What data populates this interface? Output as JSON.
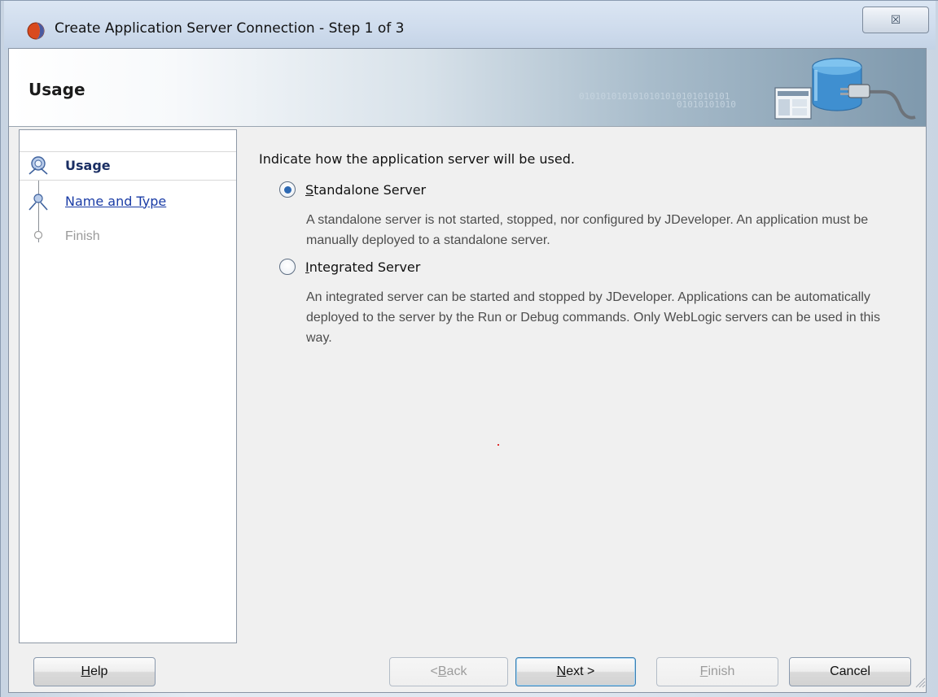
{
  "window": {
    "title": "Create Application Server Connection - Step 1 of 3",
    "close_glyph": "☒"
  },
  "banner": {
    "title": "Usage",
    "binary_1": "0101010101010101010101010101",
    "binary_2": "01010101010"
  },
  "nav": {
    "items": [
      {
        "label": "Usage",
        "state": "current"
      },
      {
        "label": "Name and Type",
        "state": "link"
      },
      {
        "label": "Finish",
        "state": "disabled"
      }
    ]
  },
  "content": {
    "prompt": "Indicate how  the application server will be used.",
    "options": [
      {
        "mnemonic": "S",
        "label_rest": "tandalone Server",
        "selected": true,
        "description": "A standalone server is not started, stopped, nor configured by JDeveloper. An application must be manually deployed to a standalone server."
      },
      {
        "mnemonic": "I",
        "label_rest": "ntegrated Server",
        "selected": false,
        "description": "An integrated server can be started and stopped by JDeveloper. Applications can be automatically deployed to the server by the Run or Debug commands. Only WebLogic servers can be used in this way."
      }
    ]
  },
  "buttons": {
    "help": {
      "mnemonic": "H",
      "rest": "elp"
    },
    "back": {
      "prefix": "< ",
      "mnemonic": "B",
      "rest": "ack"
    },
    "next": {
      "mnemonic": "N",
      "rest": "ext >"
    },
    "finish": {
      "mnemonic": "F",
      "rest": "inish"
    },
    "cancel": {
      "label": "Cancel"
    }
  },
  "colors": {
    "accent": "#2d69b3",
    "link": "#1a3ca6",
    "disabled": "#9a9a9a"
  }
}
